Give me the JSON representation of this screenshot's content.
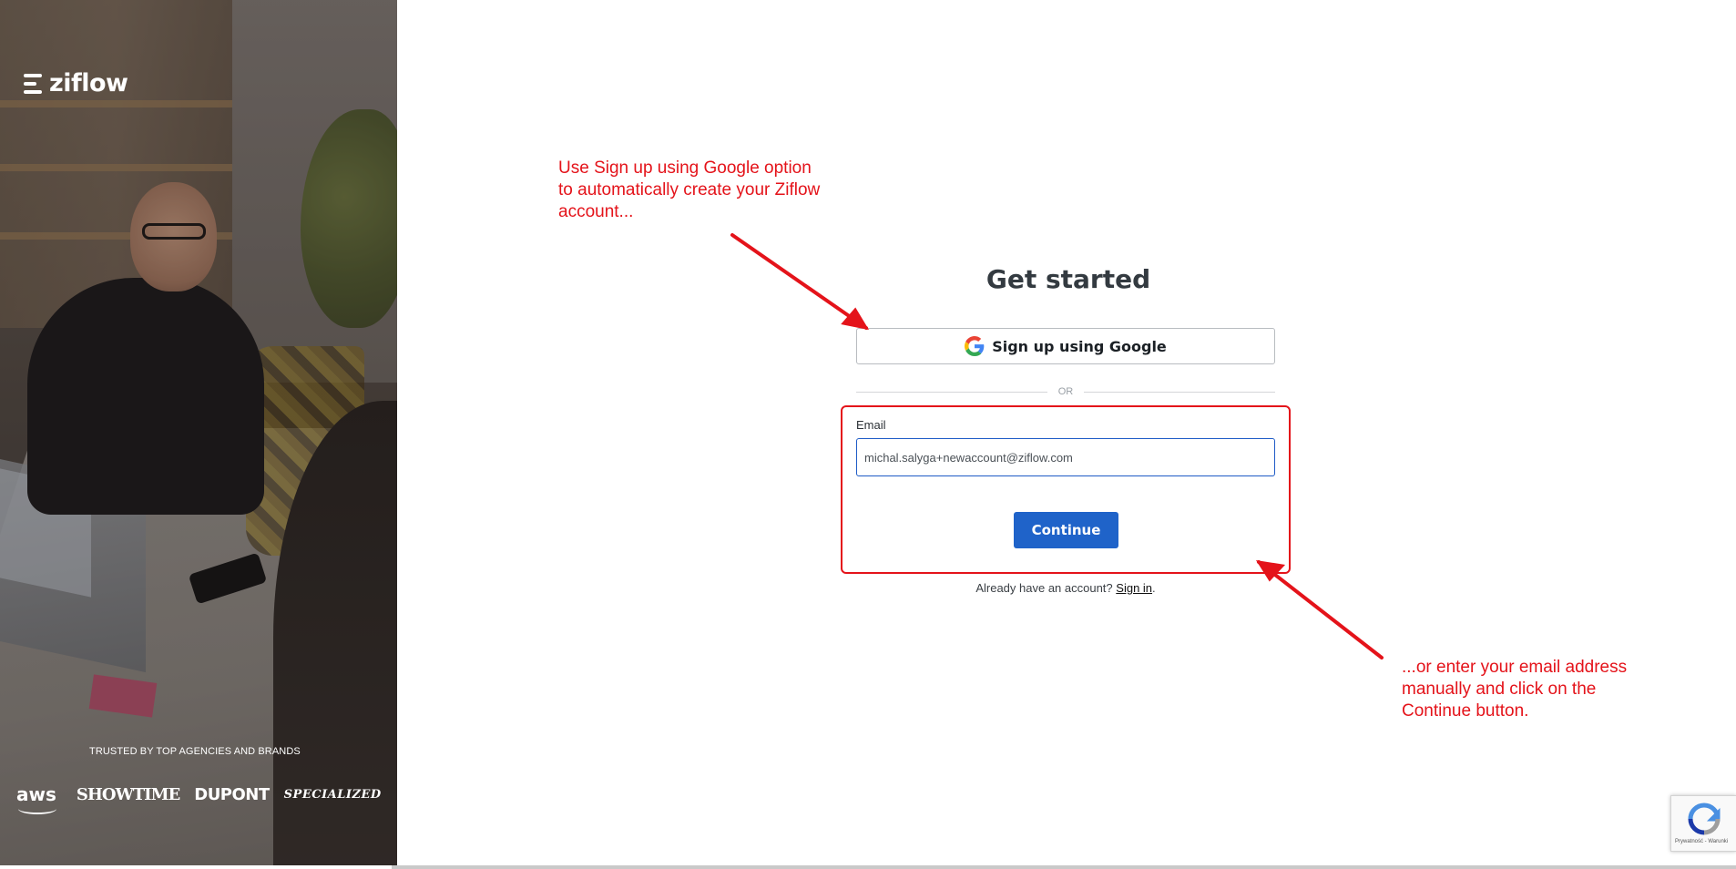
{
  "brand": {
    "logo_text": "ziflow",
    "trusted_text": "TRUSTED BY TOP AGENCIES AND BRANDS",
    "partners": [
      "aws",
      "SHOWTIME",
      "DUPONT",
      "SPECIALIZED"
    ]
  },
  "form": {
    "title": "Get started",
    "google_button_label": "Sign up using Google",
    "divider_text": "OR",
    "email_label": "Email",
    "email_value": "michal.salyga+newaccount@ziflow.com",
    "continue_label": "Continue",
    "already_text": "Already have an account?",
    "signin_label": "Sign in",
    "signin_suffix": "."
  },
  "annotations": {
    "google_tip": "Use Sign up using Google option\nto automatically create your Ziflow\naccount...",
    "email_tip": "...or enter your email address\nmanually and click on the\nContinue button."
  },
  "recaptcha": {
    "footer_text": "Prywatność - Warunki"
  },
  "colors": {
    "accent": "#1f63c9",
    "annotation": "#e4131a",
    "title": "#333a40"
  },
  "icons": [
    "google-icon",
    "ziflow-logo-icon",
    "recaptcha-icon",
    "arrow-icon"
  ]
}
